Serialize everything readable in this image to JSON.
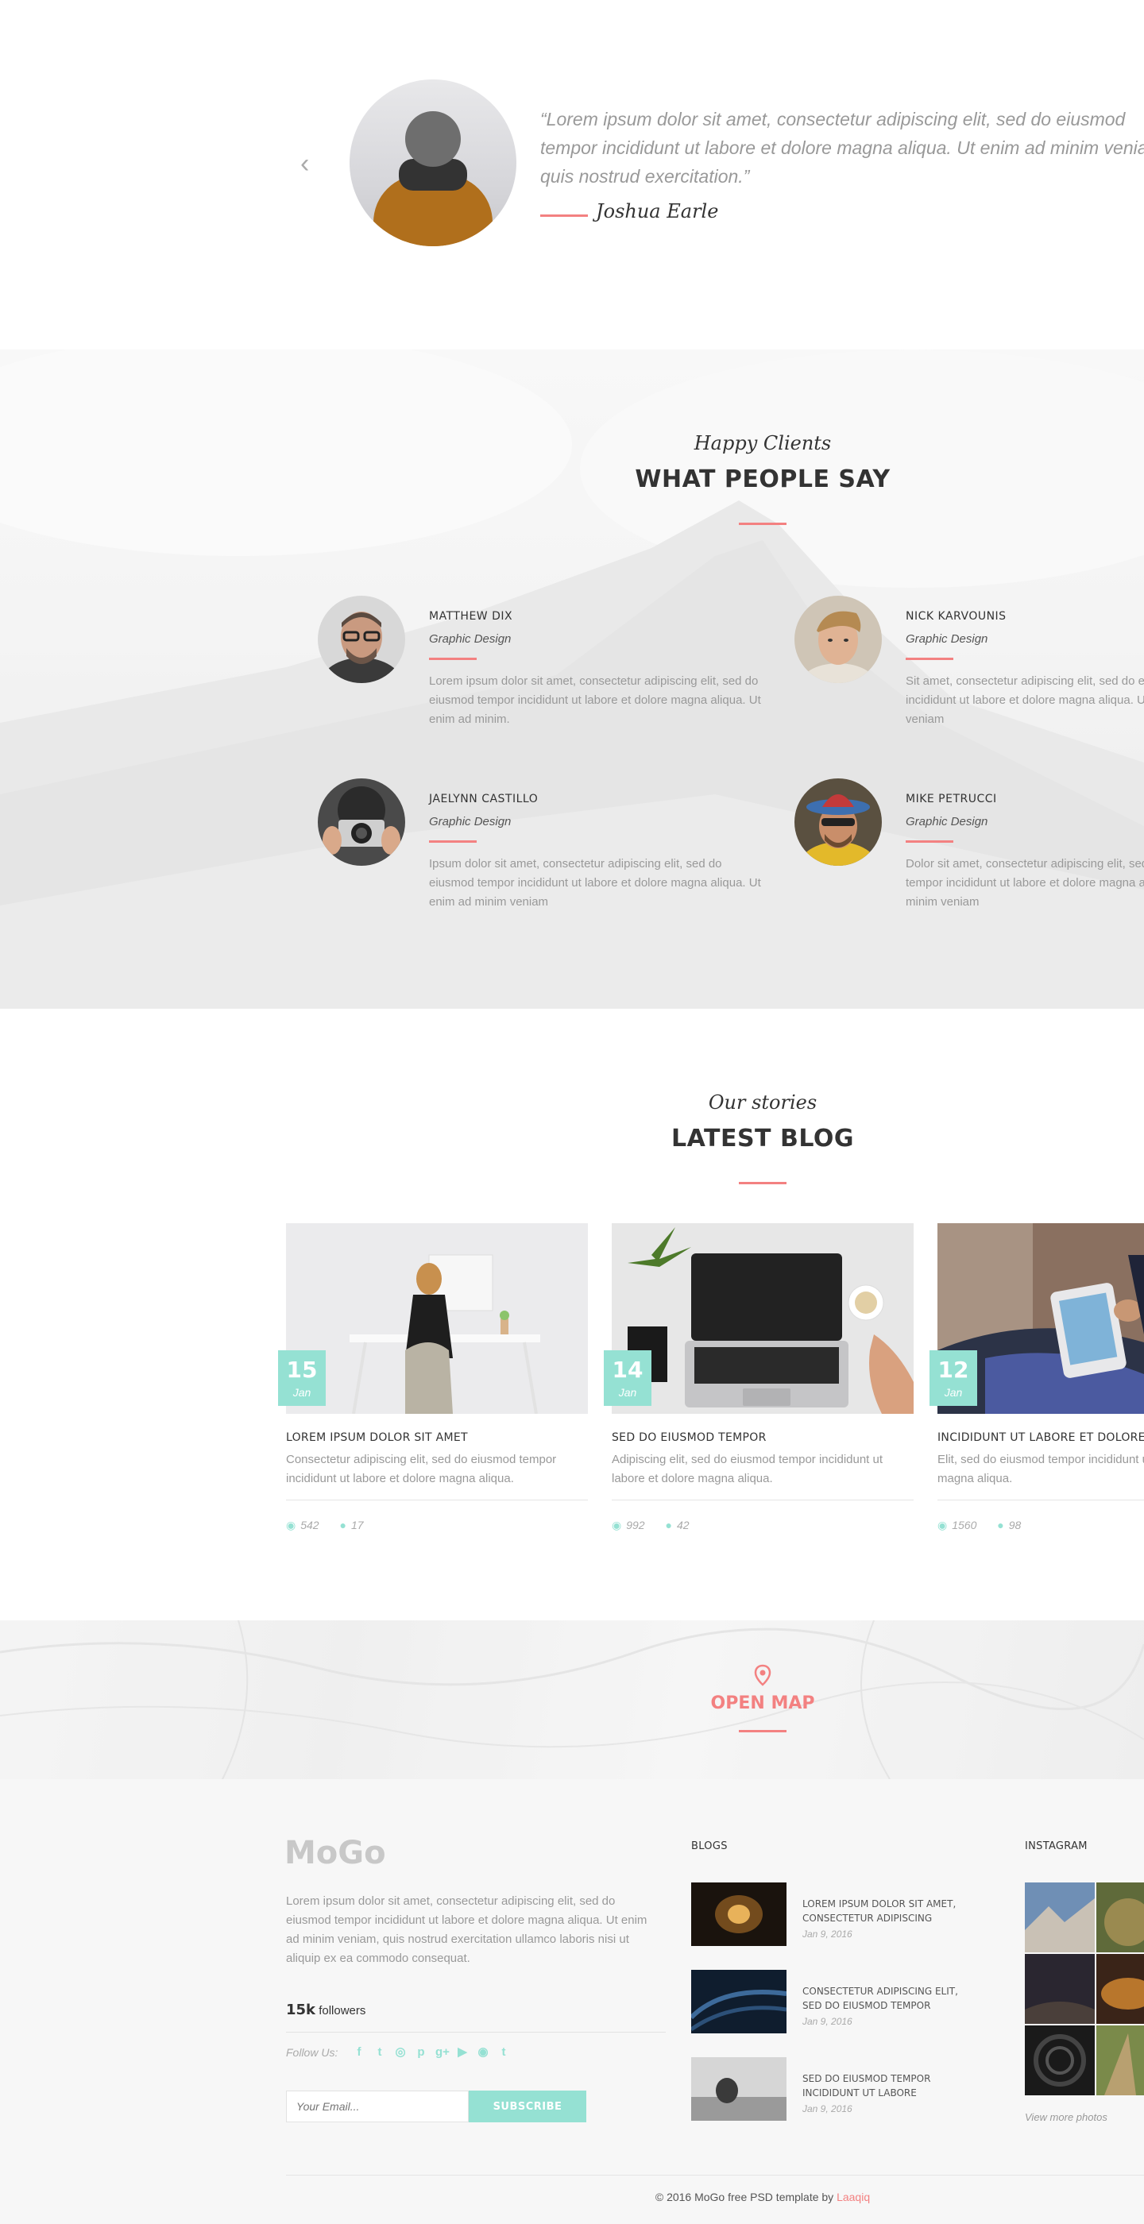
{
  "testimonial": {
    "quote": "“Lorem ipsum dolor sit amet, consectetur adipiscing elit, sed do eiusmod tempor incididunt ut labore et dolore magna aliqua. Ut enim ad minim veniam, quis nostrud exercitation.”",
    "quote_lines": [
      "“Lorem ipsum dolor sit amet, consectetur adipiscing elit, sed do eiusmod",
      "tempor incididunt ut labore et dolore magna aliqua. Ut enim ad minim veniam,",
      "quis nostrud exercitation.”"
    ],
    "author": "Joshua Earle",
    "prev_icon": "‹"
  },
  "clients": {
    "subtitle": "Happy Clients",
    "title": "WHAT PEOPLE SAY",
    "items": [
      {
        "name": "MATTHEW DIX",
        "role": "Graphic Design",
        "text": "Lorem ipsum dolor sit amet, consectetur adipiscing elit, sed do eiusmod tempor incididunt ut labore et dolore magna aliqua. Ut enim ad minim."
      },
      {
        "name": "NICK KARVOUNIS",
        "role": "Graphic Design",
        "text": "Sit amet, consectetur adipiscing elit, sed do eiusmod tempor incididunt ut labore et dolore magna aliqua. Ut enim ad minim veniam"
      },
      {
        "name": "JAELYNN CASTILLO",
        "role": "Graphic Design",
        "text": "Ipsum dolor sit amet, consectetur adipiscing elit, sed do eiusmod tempor incididunt ut labore et dolore magna aliqua. Ut enim ad minim veniam"
      },
      {
        "name": "MIKE PETRUCCI",
        "role": "Graphic Design",
        "text": "Dolor sit amet, consectetur adipiscing elit, sed do eiusmod tempor incididunt ut labore et dolore magna aliqua. Ut enim ad minim veniam"
      }
    ]
  },
  "blog": {
    "subtitle": "Our stories",
    "title": "LATEST BLOG",
    "posts": [
      {
        "day": "15",
        "month": "Jan",
        "title": "LOREM IPSUM DOLOR SIT AMET",
        "text": "Consectetur adipiscing elit, sed do eiusmod tempor incididunt ut labore et dolore magna aliqua.",
        "views": "542",
        "comments": "17"
      },
      {
        "day": "14",
        "month": "Jan",
        "title": "SED DO EIUSMOD TEMPOR",
        "text": "Adipiscing elit, sed do eiusmod tempor incididunt ut labore et dolore magna aliqua.",
        "views": "992",
        "comments": "42"
      },
      {
        "day": "12",
        "month": "Jan",
        "title": "INCIDIDUNT UT LABORE ET DOLORE",
        "text": "Elit, sed do eiusmod tempor incididunt ut labore et dolore magna aliqua.",
        "views": "1560",
        "comments": "98"
      }
    ],
    "views_icon": "eye-icon",
    "comments_icon": "comment-icon"
  },
  "map": {
    "label": "OPEN MAP",
    "icon": "map-pin-icon"
  },
  "footer": {
    "logo": "MoGo",
    "about": "Lorem ipsum dolor sit amet, consectetur adipiscing elit, sed do eiusmod tempor incididunt ut labore et dolore magna aliqua. Ut enim ad minim veniam, quis nostrud exercitation ullamco laboris nisi ut aliquip ex ea commodo consequat.",
    "followers_count": "15k",
    "followers_label": "followers",
    "follow_us": "Follow Us:",
    "social": [
      "f",
      "t",
      "◎",
      "p",
      "g+",
      "▶",
      "◉",
      "t"
    ],
    "email_placeholder": "Your Email...",
    "subscribe": "SUBSCRIBE",
    "blogs_title": "BLOGS",
    "blogs": [
      {
        "title": "LOREM IPSUM DOLOR SIT AMET, CONSECTETUR ADIPISCING",
        "date": "Jan 9, 2016"
      },
      {
        "title": "CONSECTETUR ADIPISCING ELIT, SED DO EIUSMOD TEMPOR",
        "date": "Jan 9, 2016"
      },
      {
        "title": "SED DO EIUSMOD TEMPOR INCIDIDUNT UT LABORE",
        "date": "Jan 9, 2016"
      }
    ],
    "instagram_title": "INSTAGRAM",
    "view_more": "View more photos",
    "copyright_prefix": "© 2016 MoGo free PSD template by ",
    "copyright_link": "Laaqiq"
  },
  "colors": {
    "accent_red": "#f38181",
    "accent_mint": "#95e1d3",
    "text_dark": "#333333",
    "text_muted": "#999999"
  }
}
